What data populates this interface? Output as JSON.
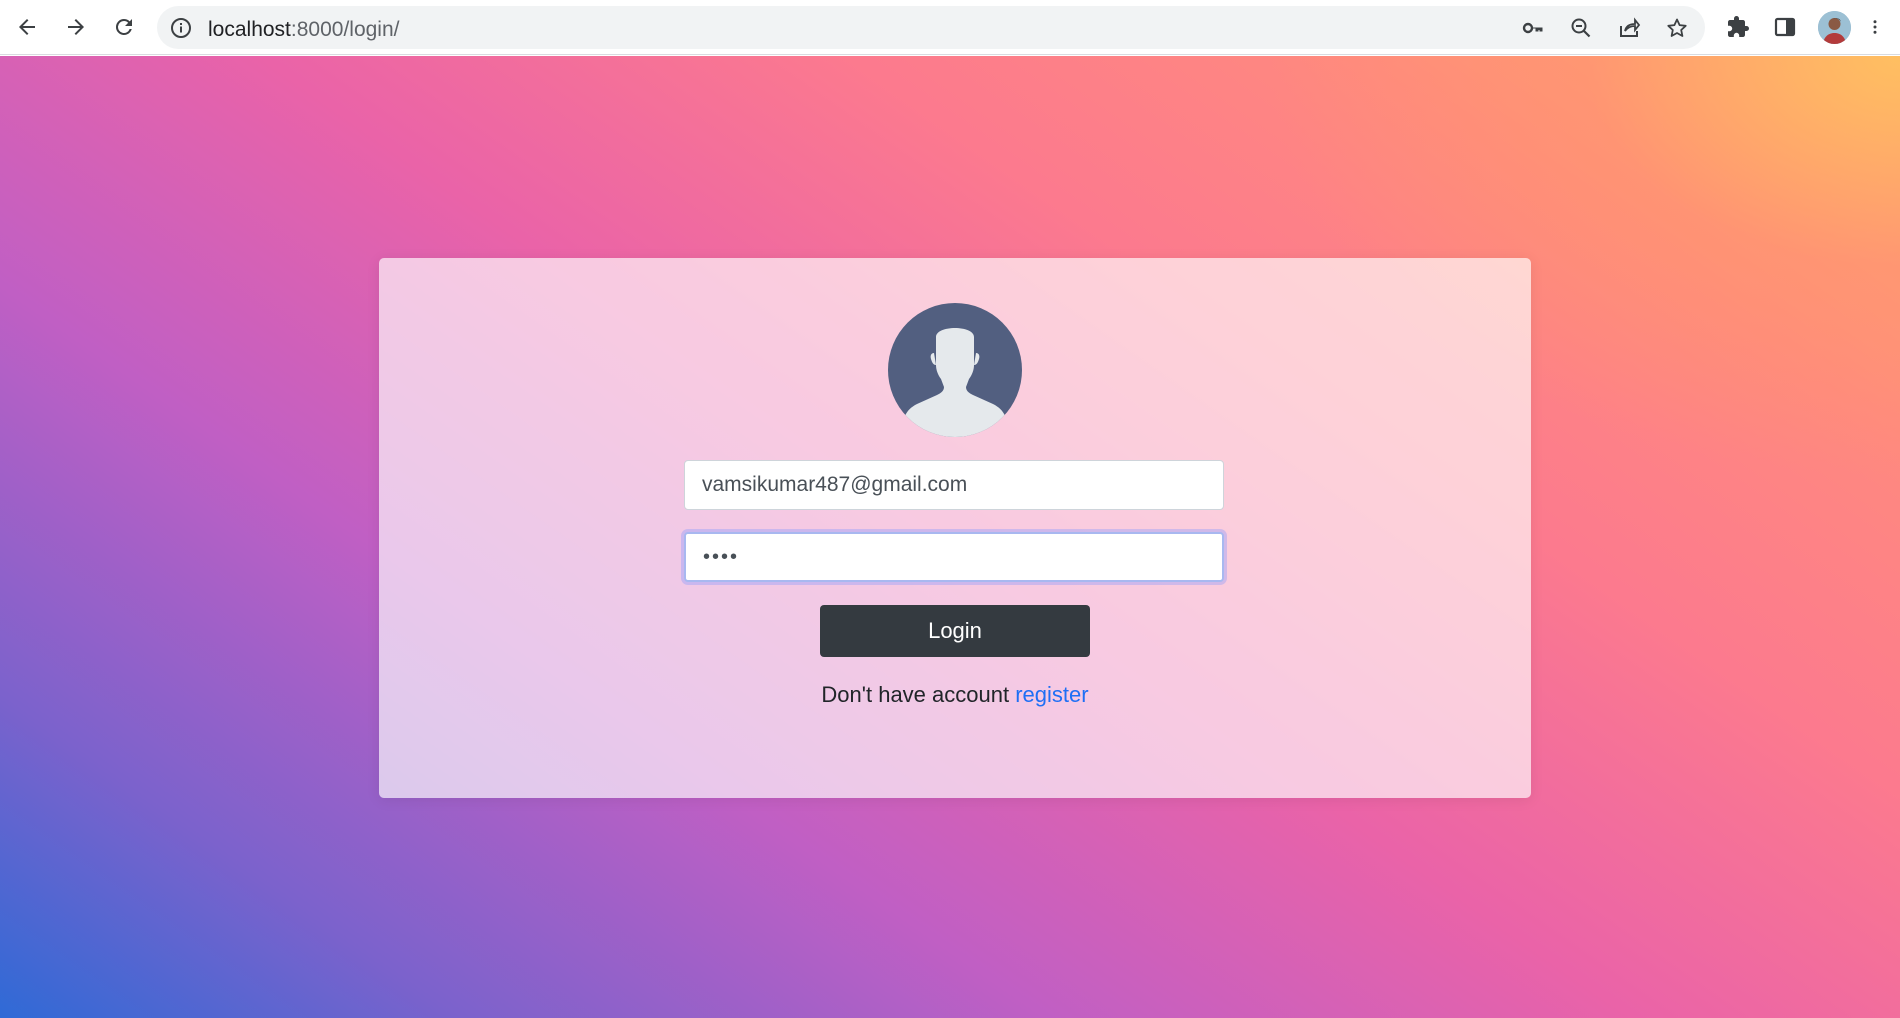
{
  "browser": {
    "url_host": "localhost",
    "url_path": ":8000/login/",
    "icons": {
      "back": "arrow-left-icon",
      "forward": "arrow-right-icon",
      "reload": "reload-icon",
      "site_info": "info-icon",
      "password_key": "key-icon",
      "zoom": "zoom-out-icon",
      "share": "share-icon",
      "bookmark": "star-icon",
      "extensions": "puzzle-icon",
      "side_panel": "side-panel-icon",
      "menu": "kebab-menu-icon"
    }
  },
  "login_form": {
    "email_value": "vamsikumar487@gmail.com",
    "password_value": "••••",
    "login_button": "Login",
    "no_account_text": "Don't have account ",
    "register_link": "register"
  },
  "colors": {
    "button_bg": "#343a40",
    "link": "#1e6ff5",
    "avatar_bg": "#525f80"
  }
}
